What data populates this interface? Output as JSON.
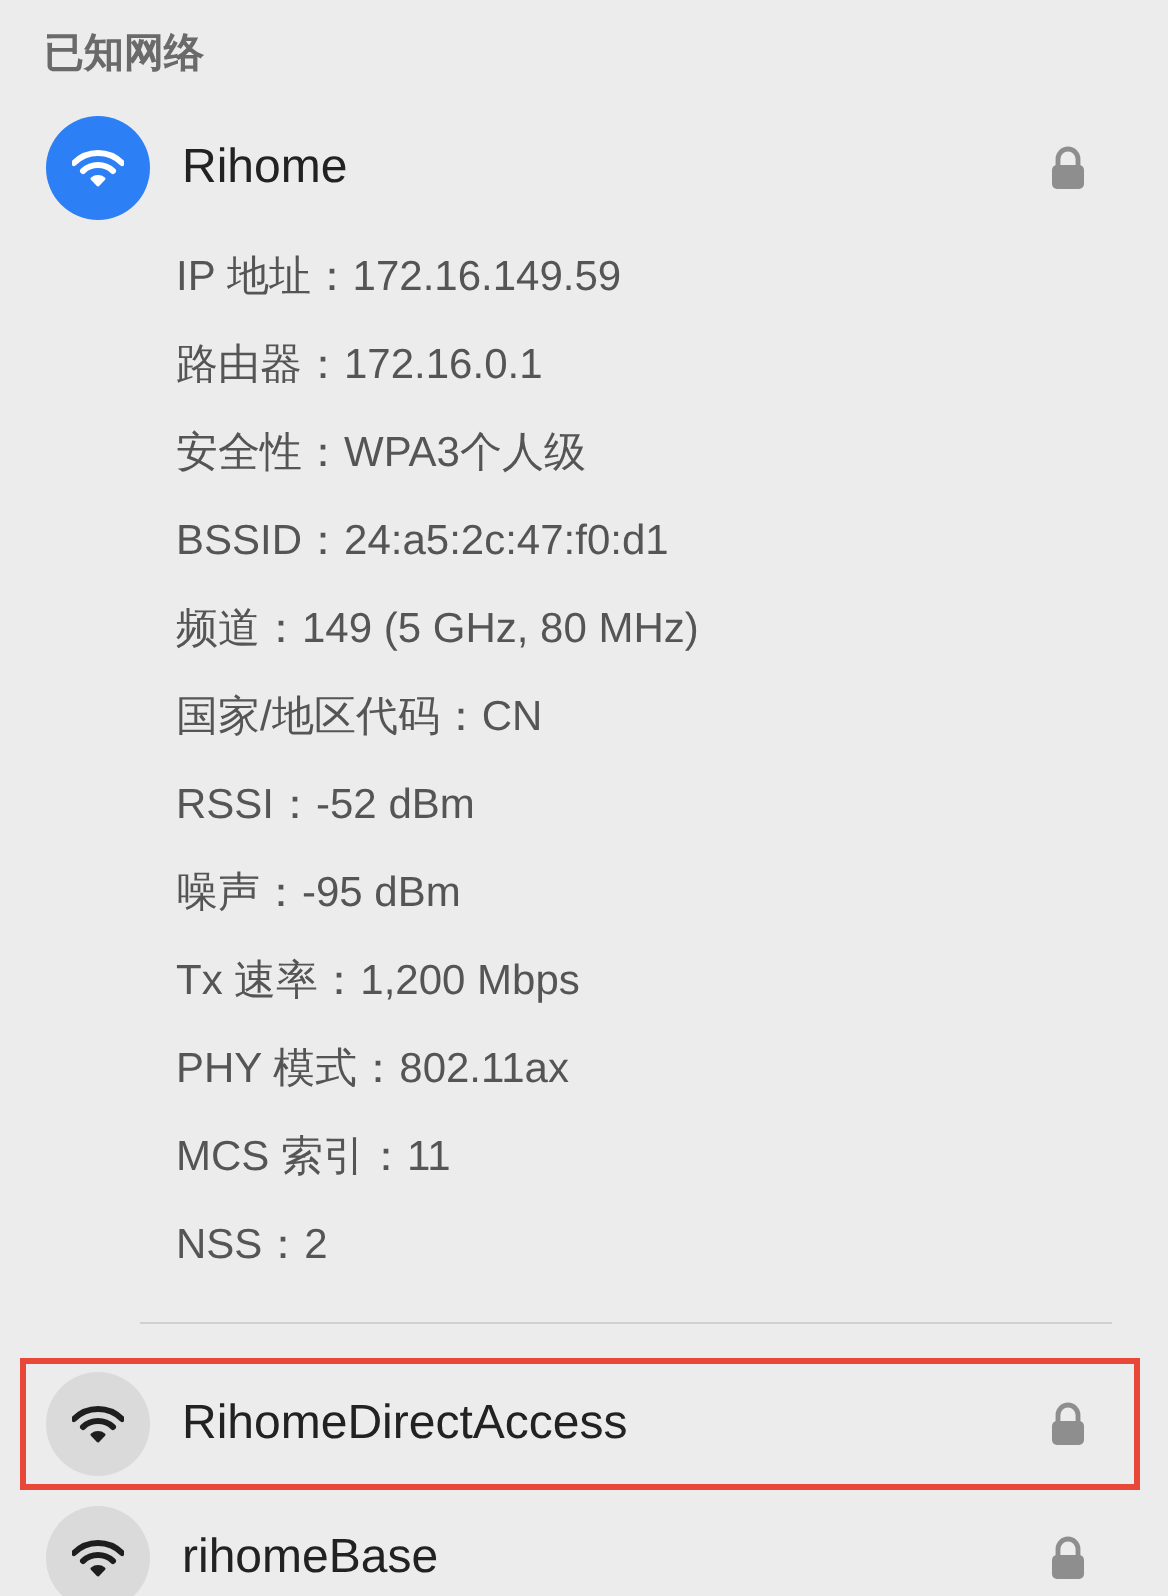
{
  "section_title": "已知网络",
  "networks": [
    {
      "name": "Rihome",
      "connected": true,
      "locked": true,
      "highlighted": false,
      "details": [
        "IP 地址：172.16.149.59",
        "路由器：172.16.0.1",
        "安全性：WPA3个人级",
        "BSSID：24:a5:2c:47:f0:d1",
        "频道：149 (5 GHz, 80 MHz)",
        "国家/地区代码：CN",
        "RSSI：-52 dBm",
        "噪声：-95 dBm",
        "Tx 速率：1,200 Mbps",
        "PHY 模式：802.11ax",
        "MCS 索引：11",
        "NSS：2"
      ]
    },
    {
      "name": "RihomeDirectAccess",
      "connected": false,
      "locked": true,
      "highlighted": true
    },
    {
      "name": "rihomeBase",
      "connected": false,
      "locked": true,
      "highlighted": false
    }
  ]
}
